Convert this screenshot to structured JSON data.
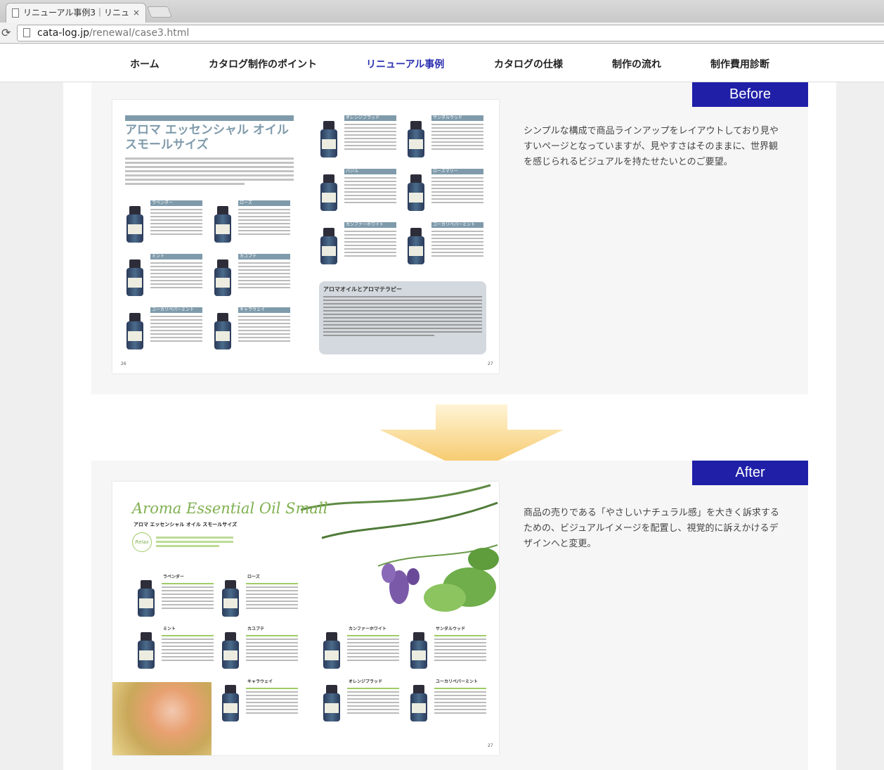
{
  "browser": {
    "tab_title": "リニューアル事例3｜リニュ",
    "tab_close": "×",
    "url_domain": "cata-log.jp",
    "url_path": "/renewal/case3.html",
    "reload_icon": "⟳"
  },
  "nav": {
    "items": [
      {
        "label": "ホーム"
      },
      {
        "label": "カタログ制作のポイント"
      },
      {
        "label": "リニューアル事例"
      },
      {
        "label": "カタログの仕様"
      },
      {
        "label": "制作の流れ"
      },
      {
        "label": "制作費用診断"
      }
    ],
    "active_index": 2
  },
  "before": {
    "badge": "Before",
    "description": "シンプルな構成で商品ラインアップをレイアウトしており見やすいページとなっていますが、見やすさはそのままに、世界観を感じられるビジュアルを持たせたいとのご要望。",
    "catalog": {
      "title_line1": "アロマ エッセンシャル オイル",
      "title_line2": "スモールサイズ",
      "products": [
        "ラベンダー",
        "ローズ",
        "ミント",
        "カユプテ",
        "ユーカリペパーミント",
        "キャラウェイ",
        "オレンジブラッド",
        "サンダルウッド",
        "バジル",
        "ローズマリー",
        "カンファーホワイト",
        "ユーカリペパーミント"
      ],
      "box_title": "アロマオイルとアロマテラピー",
      "page_left": "26",
      "page_right": "27"
    }
  },
  "after": {
    "badge": "After",
    "description": "商品の売りである「やさしいナチュラル感」を大きく訴求するための、ビジュアルイメージを配置し、視覚的に訴えかけるデザインへと変更。",
    "catalog": {
      "script_title": "Aroma Essential Oil Small",
      "subtitle": "アロマ エッセンシャル オイル スモールサイズ",
      "relax": "Relax",
      "products": [
        "ラベンダー",
        "ローズ",
        "ミント",
        "カユプテ",
        "カンファーホワイト",
        "サンダルウッド",
        "キャラウェイ",
        "オレンジブラッド",
        "ユーカリペパーミント"
      ],
      "page_right": "27"
    }
  },
  "colors": {
    "badge_bg": "#1f1fa8",
    "nav_active": "#2a2fb0",
    "before_accent": "#7f9bab",
    "after_accent": "#7fb050",
    "arrow": "#f7c96a"
  }
}
